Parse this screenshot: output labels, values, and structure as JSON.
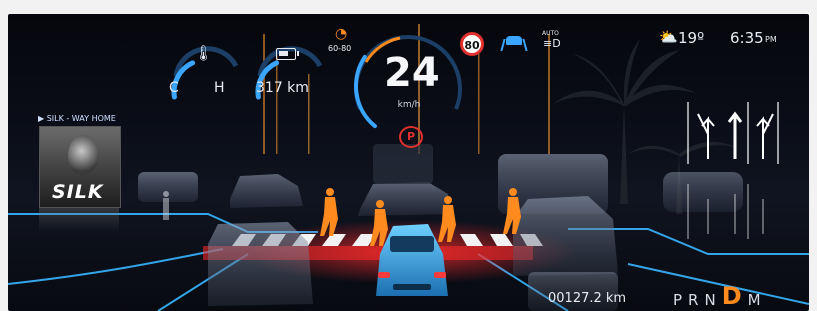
{
  "media": {
    "now_playing": "▶ SILK - WAY HOME",
    "album_text": "SILK"
  },
  "gauges": {
    "temperature": {
      "low_label": "C",
      "high_label": "H",
      "icon": "thermometer-icon",
      "level": 0.55
    },
    "range": {
      "value": "317 km",
      "icon": "battery-icon",
      "level": 0.55
    }
  },
  "speed": {
    "value": "24",
    "unit": "km/h",
    "limit_range": "60-80",
    "level": 0.3
  },
  "speed_limit_sign": "80",
  "headlights": {
    "label": "AUTO"
  },
  "weather": {
    "temperature": "19º",
    "icon": "partly-cloudy-icon"
  },
  "clock": {
    "time": "6:35",
    "ampm": "PM"
  },
  "odometer": "00127.2 km",
  "gear": {
    "letters": [
      "P",
      "R",
      "N",
      "D",
      "M"
    ],
    "active": "D"
  },
  "colors": {
    "accent_blue": "#3aa6ff",
    "accent_orange": "#ff8a1e",
    "warn_red": "#e0312f"
  }
}
